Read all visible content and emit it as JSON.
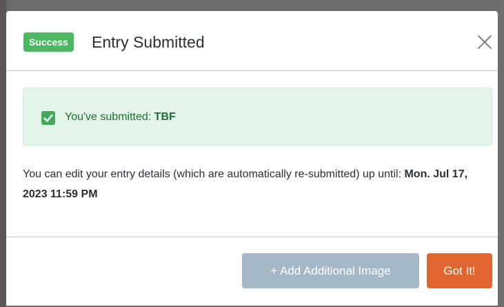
{
  "modal": {
    "badge": "Success",
    "title": "Entry Submitted",
    "close_icon": "close-icon"
  },
  "alert": {
    "icon": "check-icon",
    "label": "You've submitted:",
    "value": "TBF",
    "color": "#1f6b35",
    "background": "#e3f5e8"
  },
  "body": {
    "message": "You can edit your entry details (which are automatically re-submitted) up until:",
    "deadline": "Mon. Jul 17, 2023 11:59 PM"
  },
  "footer": {
    "add_image_label": "+ Add Additional Image",
    "got_it_label": "Got It!"
  },
  "colors": {
    "success": "#4cb663",
    "accent": "#e0652f",
    "disabled_button": "#a4b8c6"
  }
}
